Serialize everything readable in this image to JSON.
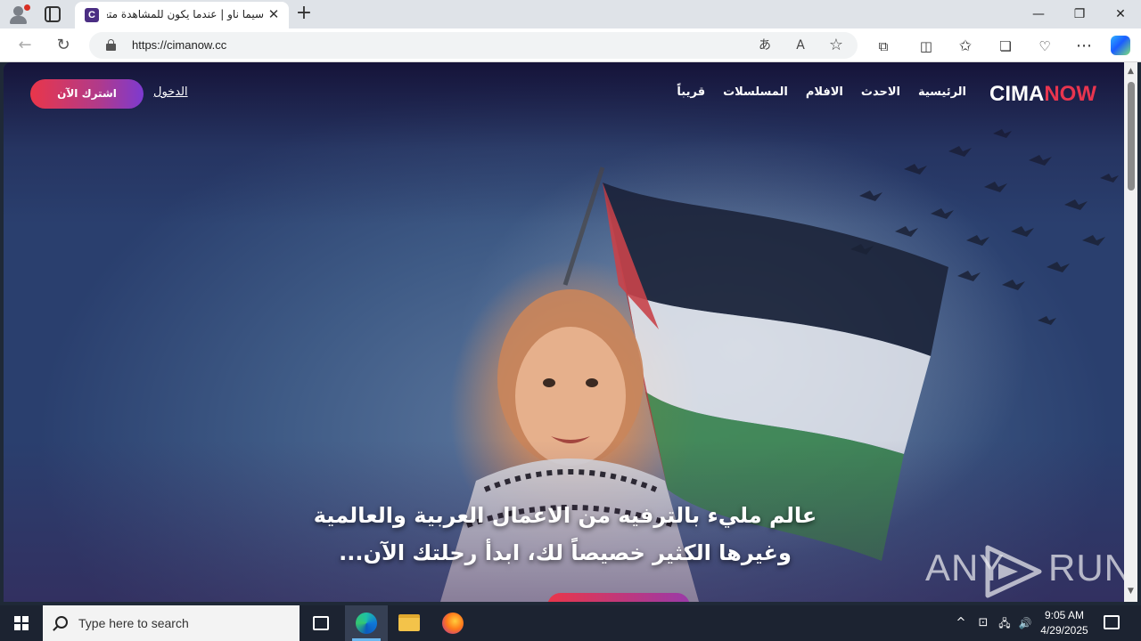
{
  "browser": {
    "tab_title": "سيما ناو | عندما يكون للمشاهدة متعة",
    "favicon_letter": "C",
    "tab_close": "✕",
    "new_tab": "+",
    "url": "https://cimanow.cc",
    "window_controls": {
      "minimize": "—",
      "maximize": "❐",
      "close": "✕"
    },
    "nav": {
      "back": "←",
      "refresh": "↻"
    },
    "omnibox_icons": {
      "translate": "あ",
      "read_aloud": "A",
      "favorite": "☆"
    },
    "toolbar_icons": {
      "extensions": "⧉",
      "split_screen": "◫",
      "favorites": "✩",
      "collections": "❏",
      "performance": "♡",
      "more": "⋯"
    }
  },
  "site": {
    "logo": {
      "part1": "CIMA",
      "part2": "NOW"
    },
    "nav": [
      "الرئيسية",
      "الاحدث",
      "الافلام",
      "المسلسلات",
      "قريباً"
    ],
    "login": "الدخول",
    "subscribe": "اشترك الآن",
    "hero_line1": "عالم مليء بالترفيه من الاعمال العربية والعالمية",
    "hero_line2": "وغيرها الكثير خصيصاً لك، ابدأ رحلتك الآن..."
  },
  "watermark": {
    "left": "ANY",
    "right": "RUN"
  },
  "scrollbar": {
    "up": "▲",
    "down": "▼"
  },
  "taskbar": {
    "search_placeholder": "Type here to search",
    "time": "9:05 AM",
    "date": "4/29/2025",
    "tray": {
      "chevron": "^",
      "meet": "⊡",
      "network": "🖧",
      "volume": "🔊"
    }
  },
  "colors": {
    "brand_red": "#e8354f",
    "cta_start": "#e9364a",
    "cta_end": "#7d3ad0",
    "taskbar": "#1c2331"
  }
}
